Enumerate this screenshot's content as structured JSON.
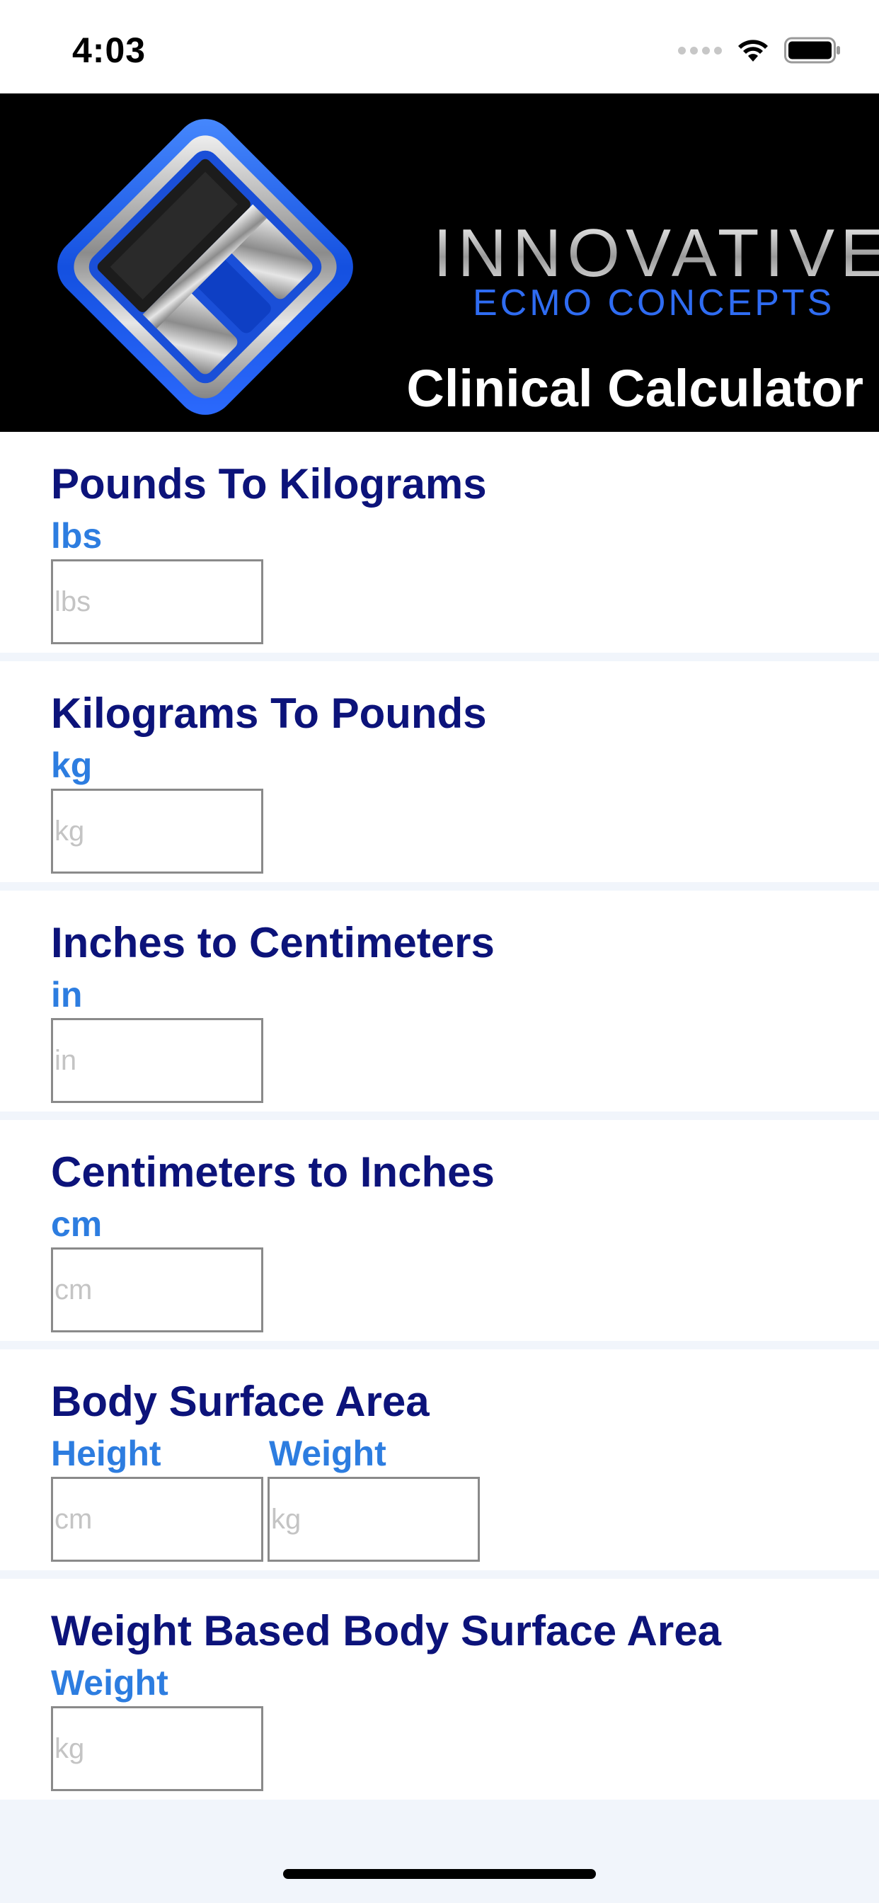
{
  "status_bar": {
    "time": "4:03",
    "icons": [
      "signal-icon",
      "wifi-icon",
      "battery-icon"
    ]
  },
  "header": {
    "brand_name": "INNOVATIVE",
    "brand_sub": "ECMO CONCEPTS",
    "title": "Clinical Calculator",
    "colors": {
      "background": "#000000",
      "brand_blue": "#2f6cf2"
    }
  },
  "calculators": [
    {
      "title": "Pounds To Kilograms",
      "fields": [
        {
          "label": "lbs",
          "placeholder": "lbs",
          "value": ""
        }
      ]
    },
    {
      "title": "Kilograms To Pounds",
      "fields": [
        {
          "label": "kg",
          "placeholder": "kg",
          "value": ""
        }
      ]
    },
    {
      "title": "Inches to Centimeters",
      "fields": [
        {
          "label": "in",
          "placeholder": "in",
          "value": ""
        }
      ]
    },
    {
      "title": "Centimeters to Inches",
      "fields": [
        {
          "label": "cm",
          "placeholder": "cm",
          "value": ""
        }
      ]
    },
    {
      "title": "Body Surface Area",
      "fields": [
        {
          "label": "Height",
          "placeholder": "cm",
          "value": ""
        },
        {
          "label": "Weight",
          "placeholder": "kg",
          "value": ""
        }
      ]
    },
    {
      "title": "Weight Based Body Surface Area",
      "fields": [
        {
          "label": "Weight",
          "placeholder": "kg",
          "value": ""
        }
      ]
    }
  ],
  "theme": {
    "title_color": "#0c137a",
    "label_color": "#2d7de0",
    "separator_color": "#f1f5fb"
  }
}
